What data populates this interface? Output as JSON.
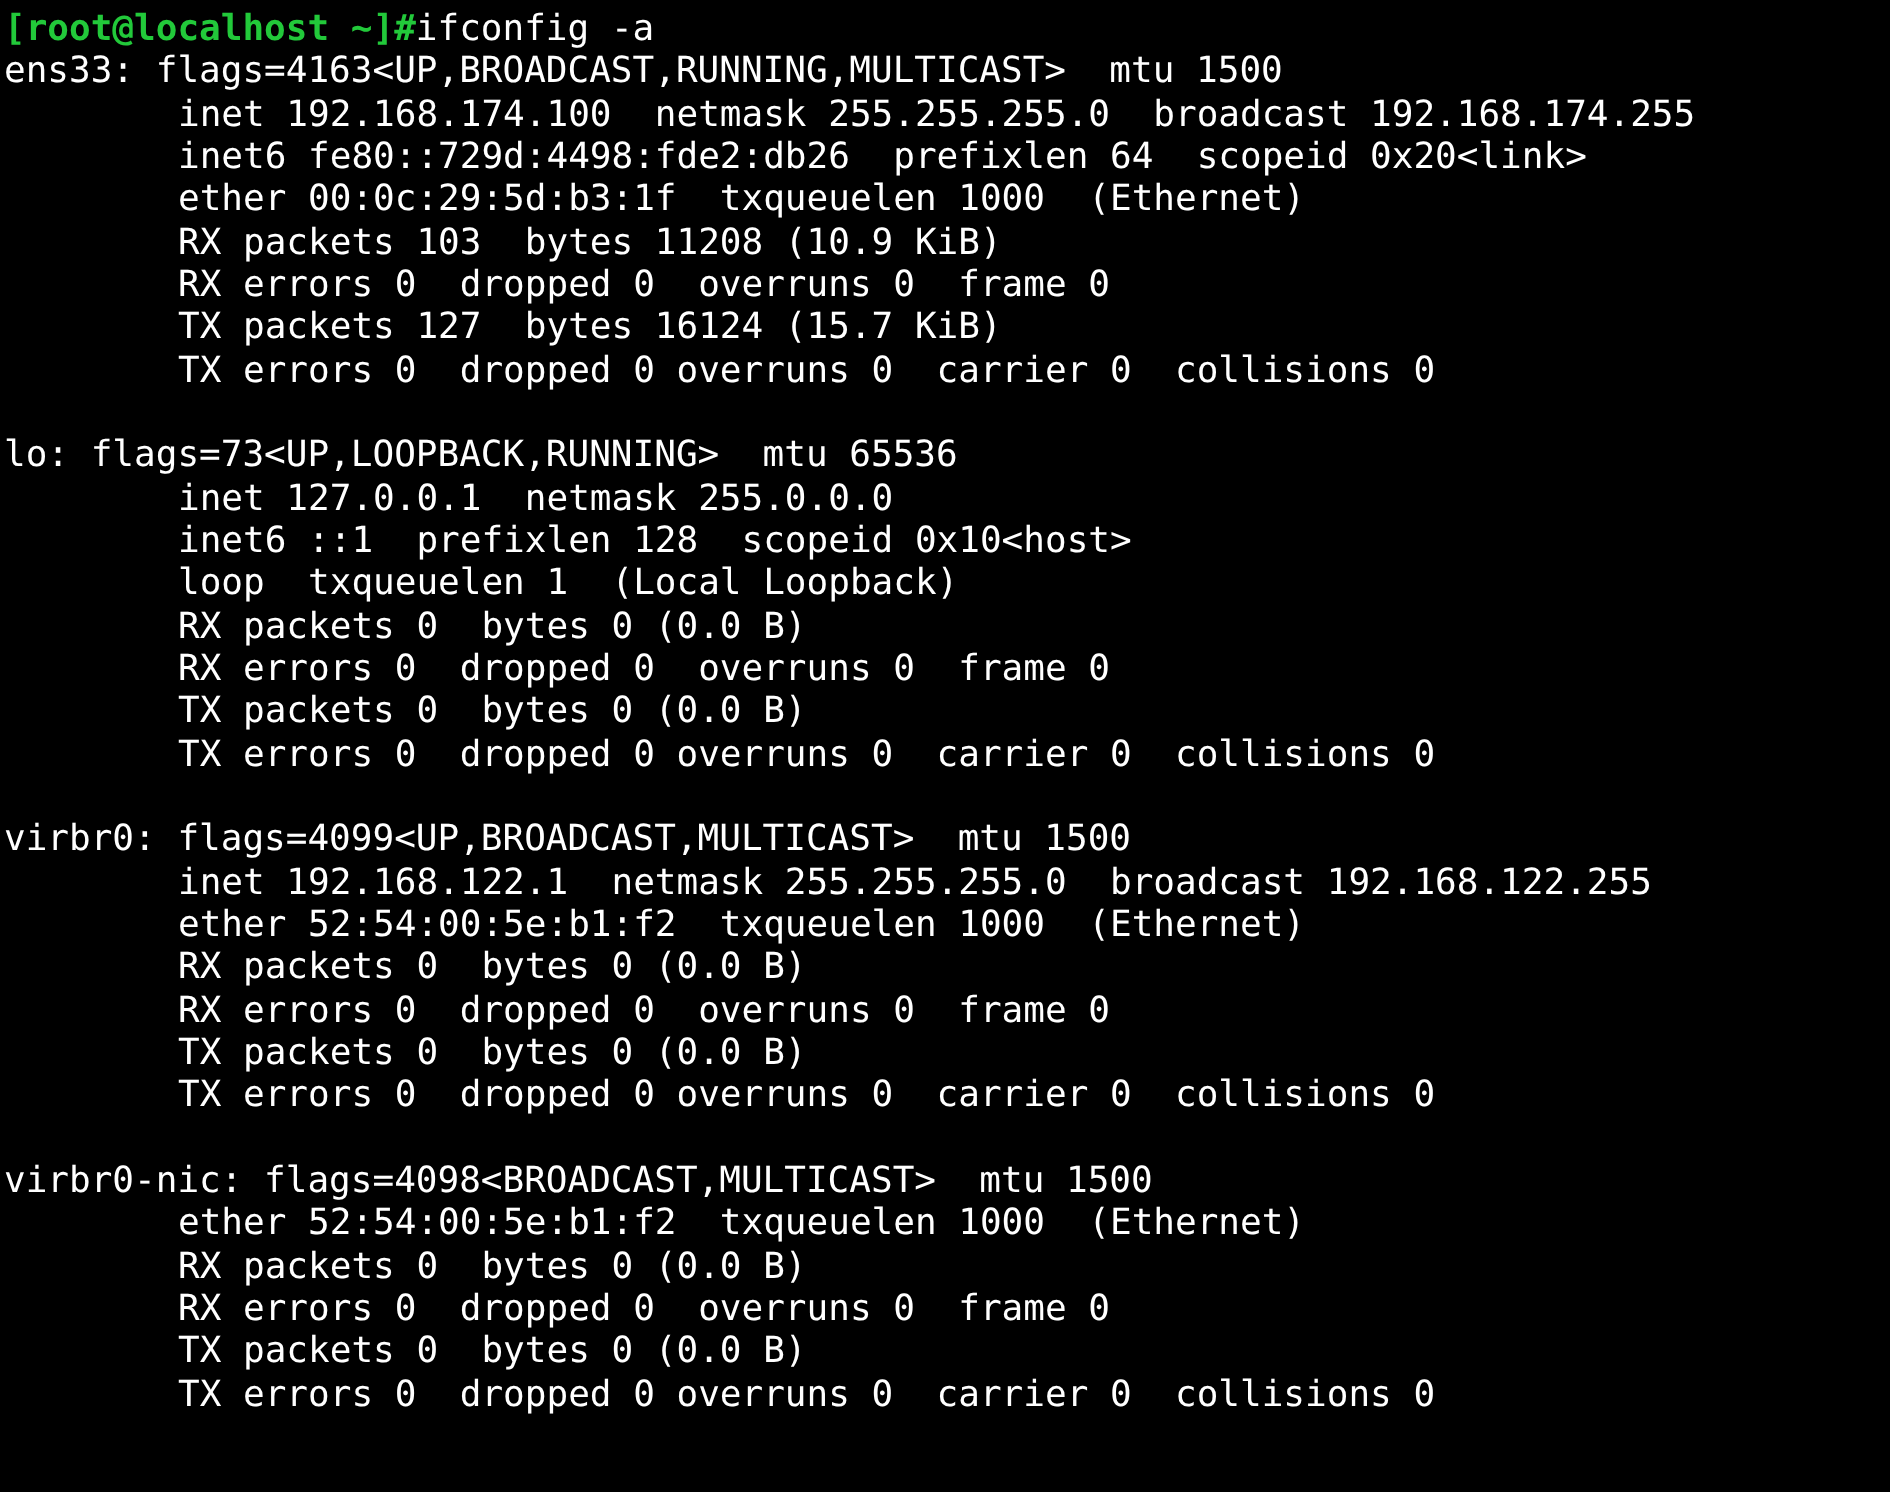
{
  "prompt": {
    "text": "[root@localhost ~]#",
    "command": "ifconfig -a"
  },
  "interfaces": [
    {
      "header": "ens33: flags=4163<UP,BROADCAST,RUNNING,MULTICAST>  mtu 1500",
      "lines": [
        "inet 192.168.174.100  netmask 255.255.255.0  broadcast 192.168.174.255",
        "inet6 fe80::729d:4498:fde2:db26  prefixlen 64  scopeid 0x20<link>",
        "ether 00:0c:29:5d:b3:1f  txqueuelen 1000  (Ethernet)",
        "RX packets 103  bytes 11208 (10.9 KiB)",
        "RX errors 0  dropped 0  overruns 0  frame 0",
        "TX packets 127  bytes 16124 (15.7 KiB)",
        "TX errors 0  dropped 0 overruns 0  carrier 0  collisions 0"
      ]
    },
    {
      "header": "lo: flags=73<UP,LOOPBACK,RUNNING>  mtu 65536",
      "lines": [
        "inet 127.0.0.1  netmask 255.0.0.0",
        "inet6 ::1  prefixlen 128  scopeid 0x10<host>",
        "loop  txqueuelen 1  (Local Loopback)",
        "RX packets 0  bytes 0 (0.0 B)",
        "RX errors 0  dropped 0  overruns 0  frame 0",
        "TX packets 0  bytes 0 (0.0 B)",
        "TX errors 0  dropped 0 overruns 0  carrier 0  collisions 0"
      ]
    },
    {
      "header": "virbr0: flags=4099<UP,BROADCAST,MULTICAST>  mtu 1500",
      "lines": [
        "inet 192.168.122.1  netmask 255.255.255.0  broadcast 192.168.122.255",
        "ether 52:54:00:5e:b1:f2  txqueuelen 1000  (Ethernet)",
        "RX packets 0  bytes 0 (0.0 B)",
        "RX errors 0  dropped 0  overruns 0  frame 0",
        "TX packets 0  bytes 0 (0.0 B)",
        "TX errors 0  dropped 0 overruns 0  carrier 0  collisions 0"
      ]
    },
    {
      "header": "virbr0-nic: flags=4098<BROADCAST,MULTICAST>  mtu 1500",
      "lines": [
        "ether 52:54:00:5e:b1:f2  txqueuelen 1000  (Ethernet)",
        "RX packets 0  bytes 0 (0.0 B)",
        "RX errors 0  dropped 0  overruns 0  frame 0",
        "TX packets 0  bytes 0 (0.0 B)",
        "TX errors 0  dropped 0 overruns 0  carrier 0  collisions 0"
      ]
    }
  ]
}
